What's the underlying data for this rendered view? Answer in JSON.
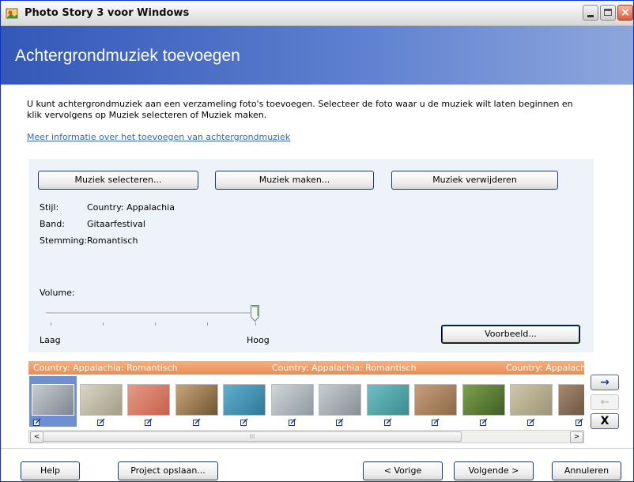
{
  "window": {
    "title": "Photo Story 3 voor Windows"
  },
  "header": {
    "title": "Achtergrondmuziek toevoegen"
  },
  "intro": {
    "text": "U kunt achtergrondmuziek aan een verzameling foto's toevoegen. Selecteer de foto waar u de muziek wilt laten beginnen en klik vervolgens op Muziek selecteren of Muziek maken.",
    "link": "Meer informatie over het toevoegen van achtergrondmuziek"
  },
  "buttons": {
    "select_music": "Muziek selecteren...",
    "make_music": "Muziek maken...",
    "remove_music": "Muziek verwijderen",
    "preview": "Voorbeeld..."
  },
  "properties": [
    {
      "label": "Stijl:",
      "value": "Country: Appalachia"
    },
    {
      "label": "Band:",
      "value": "Gitaarfestival"
    },
    {
      "label": "Stemming:",
      "value": "Romantisch"
    }
  ],
  "volume": {
    "label": "Volume:",
    "low": "Laag",
    "high": "Hoog",
    "level": 1.0
  },
  "music_bar": {
    "segments": [
      "Country: Appalachia: Romantisch",
      "Country: Appalachia: Romantisch",
      "Country: Appalach"
    ]
  },
  "filmstrip": {
    "selected_index": 0,
    "thumbnails": [
      {
        "subject": "bird",
        "colors": [
          "#c9cdd2",
          "#7c868f"
        ]
      },
      {
        "subject": "heron",
        "colors": [
          "#d9d6c7",
          "#a39d84"
        ]
      },
      {
        "subject": "flamingo",
        "colors": [
          "#e79a86",
          "#c6604b"
        ]
      },
      {
        "subject": "giraffe",
        "colors": [
          "#c9a676",
          "#6e5535"
        ]
      },
      {
        "subject": "dolphin",
        "colors": [
          "#5fb0cf",
          "#2f7896"
        ]
      },
      {
        "subject": "polar-bear",
        "colors": [
          "#d0d6d8",
          "#8f9aa0"
        ]
      },
      {
        "subject": "seal",
        "colors": [
          "#c7ccd0",
          "#888f95"
        ]
      },
      {
        "subject": "hummingbird",
        "colors": [
          "#6ec0c2",
          "#3a8c90"
        ]
      },
      {
        "subject": "deer",
        "colors": [
          "#c7a07a",
          "#8d6947"
        ]
      },
      {
        "subject": "frog",
        "colors": [
          "#7ca24a",
          "#3f5e27"
        ]
      },
      {
        "subject": "bird-branch",
        "colors": [
          "#cfc7ac",
          "#9e9474"
        ]
      },
      {
        "subject": "animal",
        "colors": [
          "#a58a72",
          "#5d4836"
        ]
      }
    ]
  },
  "scrollbar": {
    "left": "<",
    "right": ">",
    "grip": "III"
  },
  "side_buttons": {
    "move_right": "→",
    "move_left": "←",
    "remove": "X"
  },
  "footer": {
    "help": "Help",
    "save_project": "Project opslaan...",
    "previous": "< Vorige",
    "next": "Volgende >",
    "cancel": "Annuleren"
  },
  "colors": {
    "banner": "#3358b7",
    "music_bar": "#e98d52",
    "link": "#3366cc"
  }
}
